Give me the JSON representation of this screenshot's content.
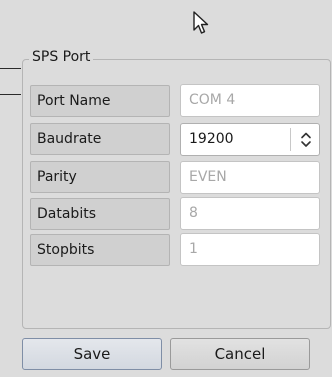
{
  "group": {
    "title": "SPS Port"
  },
  "rows": [
    {
      "label": "Port Name",
      "value": "COM 4"
    },
    {
      "label": "Baudrate",
      "value": "19200"
    },
    {
      "label": "Parity",
      "value": "EVEN"
    },
    {
      "label": "Databits",
      "value": "8"
    },
    {
      "label": "Stopbits",
      "value": "1"
    }
  ],
  "buttons": {
    "save": "Save",
    "cancel": "Cancel"
  },
  "icons": {
    "cursor": "mouse-pointer-icon",
    "combo_arrows": "up-down-arrows-icon"
  }
}
